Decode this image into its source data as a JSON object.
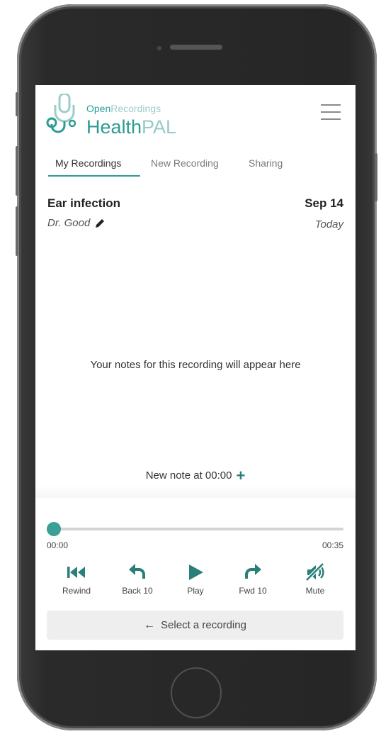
{
  "brand": {
    "top_a": "Open",
    "top_b": "Recordings",
    "main_a": "Health",
    "main_b": "PAL"
  },
  "tabs": [
    {
      "label": "My Recordings",
      "active": true
    },
    {
      "label": "New Recording",
      "active": false
    },
    {
      "label": "Sharing",
      "active": false
    }
  ],
  "recording": {
    "title": "Ear infection",
    "doctor": "Dr. Good",
    "date": "Sep 14",
    "day": "Today"
  },
  "notes": {
    "empty_text": "Your notes for this recording will appear here",
    "new_note_label": "New note at 00:00",
    "new_note_icon": "plus-icon"
  },
  "player": {
    "position": "00:00",
    "duration": "00:35",
    "progress_fraction": 0,
    "controls": [
      {
        "label": "Rewind",
        "icon": "skip-back-icon"
      },
      {
        "label": "Back 10",
        "icon": "undo-arrow-icon"
      },
      {
        "label": "Play",
        "icon": "play-icon"
      },
      {
        "label": "Fwd 10",
        "icon": "redo-arrow-icon"
      },
      {
        "label": "Mute",
        "icon": "volume-off-icon"
      }
    ],
    "select_label": "Select a recording",
    "select_icon": "arrow-left-icon"
  },
  "colors": {
    "accent": "#2d9c93",
    "knob": "#3a9f96",
    "accent_light": "#94ccc7"
  }
}
